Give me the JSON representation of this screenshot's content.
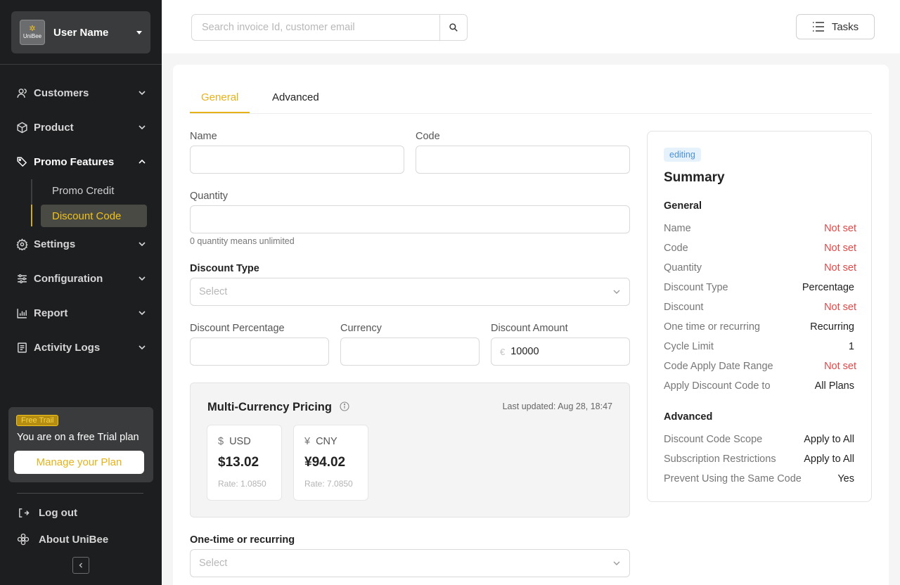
{
  "sidebar": {
    "logo_text": "UniBee",
    "user_name": "User Name",
    "nav": [
      {
        "label": "Customers",
        "icon": "users-icon"
      },
      {
        "label": "Product",
        "icon": "box-icon"
      },
      {
        "label": "Promo Features",
        "icon": "tag-icon"
      },
      {
        "label": "Settings",
        "icon": "gear-icon"
      },
      {
        "label": "Configuration",
        "icon": "sliders-icon"
      },
      {
        "label": "Report",
        "icon": "bar-chart-icon"
      },
      {
        "label": "Activity Logs",
        "icon": "document-icon"
      }
    ],
    "promo_sub": [
      "Promo Credit",
      "Discount Code"
    ],
    "trial": {
      "badge": "Free Trail",
      "text": "You are on a free Trial plan",
      "button": "Manage your Plan"
    },
    "logout": "Log out",
    "about": "About UniBee"
  },
  "topbar": {
    "search_placeholder": "Search invoice Id, customer email",
    "tasks_label": "Tasks"
  },
  "tabs": [
    "General",
    "Advanced"
  ],
  "form": {
    "name_label": "Name",
    "code_label": "Code",
    "quantity_label": "Quantity",
    "quantity_hint": "0 quantity means unlimited",
    "discount_type_label": "Discount Type",
    "discount_type_placeholder": "Select",
    "discount_percentage_label": "Discount Percentage",
    "currency_label": "Currency",
    "discount_amount_label": "Discount Amount",
    "discount_amount_prefix": "€",
    "discount_amount_value": "10000",
    "recurring_label": "One-time or recurring",
    "recurring_placeholder": "Select"
  },
  "multi_currency": {
    "title": "Multi-Currency Pricing",
    "last_updated": "Last updated: Aug 28, 18:47",
    "currencies": [
      {
        "symbol": "$",
        "code": "USD",
        "amount": "$13.02",
        "rate": "Rate: 1.0850"
      },
      {
        "symbol": "¥",
        "code": "CNY",
        "amount": "¥94.02",
        "rate": "Rate: 7.0850"
      }
    ]
  },
  "summary": {
    "badge": "editing",
    "title": "Summary",
    "general_title": "General",
    "general_rows": [
      {
        "k": "Name",
        "v": "Not set",
        "red": true
      },
      {
        "k": "Code",
        "v": "Not set",
        "red": true
      },
      {
        "k": "Quantity",
        "v": "Not set",
        "red": true
      },
      {
        "k": "Discount Type",
        "v": "Percentage",
        "red": false
      },
      {
        "k": "Discount",
        "v": "Not set",
        "red": true
      },
      {
        "k": "One time or recurring",
        "v": "Recurring",
        "red": false
      },
      {
        "k": "Cycle Limit",
        "v": "1",
        "red": false
      },
      {
        "k": "Code Apply Date Range",
        "v": "Not set",
        "red": true
      },
      {
        "k": "Apply Discount Code to",
        "v": "All Plans",
        "red": false
      }
    ],
    "advanced_title": "Advanced",
    "advanced_rows": [
      {
        "k": "Discount Code Scope",
        "v": "Apply to All",
        "red": false
      },
      {
        "k": "Subscription Restrictions",
        "v": "Apply to All",
        "red": false
      },
      {
        "k": "Prevent Using the Same Code",
        "v": "Yes",
        "red": false
      }
    ]
  },
  "colors": {
    "accent": "#e6b21a",
    "sidebar_bg": "#1d1e20",
    "error": "#e04848",
    "badge_blue": "#4a90d9"
  }
}
